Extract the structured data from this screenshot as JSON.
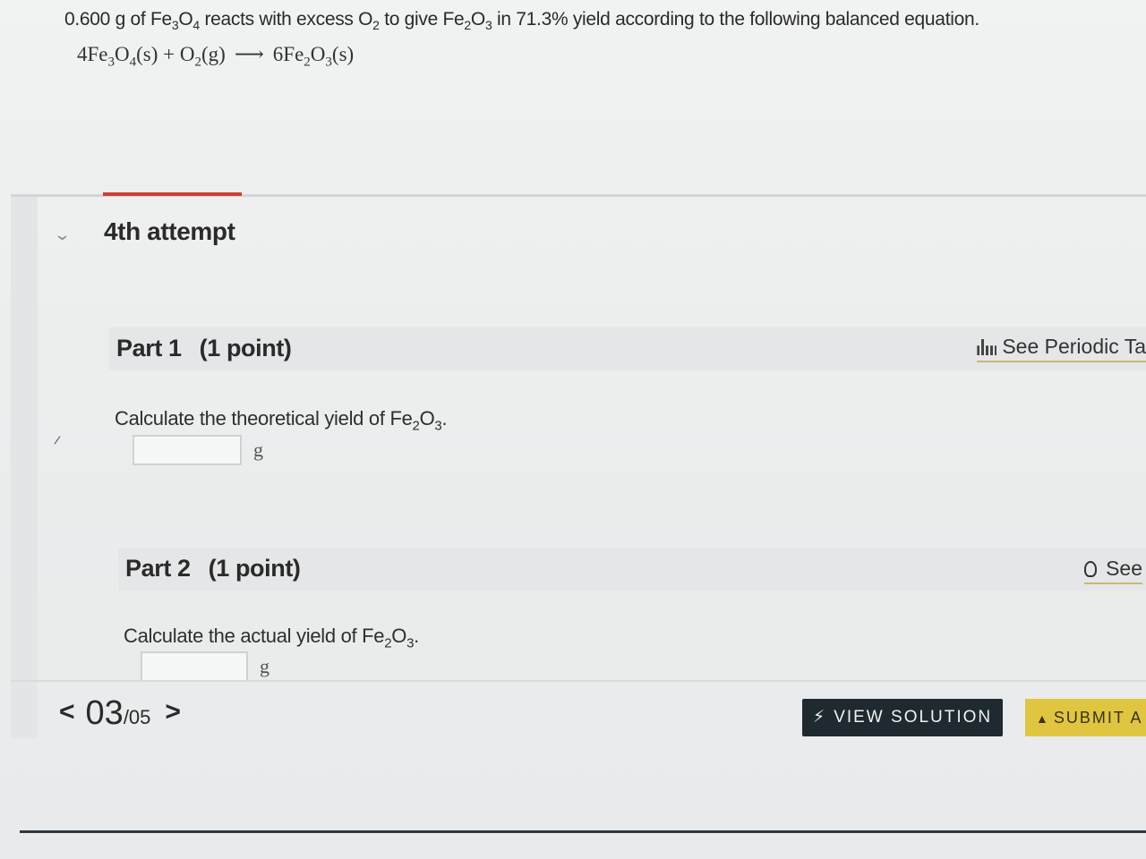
{
  "question": {
    "amount": "0.600 g of Fe",
    "sub_a": "3",
    "o_a": "O",
    "sub_b": "4",
    "mid": " reacts with excess O",
    "sub_c": "2",
    "mid2": " to give Fe",
    "sub_d": "2",
    "o_b": "O",
    "sub_e": "3",
    "tail": " in 71.3% yield according to the following balanced equation."
  },
  "equation": {
    "r1": "4Fe",
    "r1s1": "3",
    "r1o": "O",
    "r1s2": "4",
    "r1state": "(s) + O",
    "r2s": "2",
    "r2state": "(g)",
    "arrow": "⟶",
    "p1": "6Fe",
    "p1s1": "2",
    "p1o": "O",
    "p1s2": "3",
    "p1state": "(s)"
  },
  "attempt": {
    "label": "4th attempt",
    "chevron": "chevron-down-icon"
  },
  "part1": {
    "title": "Part 1",
    "points": "(1 point)",
    "link": "See Periodic Ta",
    "prompt_pre": "Calculate the theoretical yield of Fe",
    "prompt_s1": "2",
    "prompt_o": "O",
    "prompt_s2": "3",
    "prompt_end": ".",
    "unit": "g",
    "value": ""
  },
  "part2": {
    "title": "Part 2",
    "points": "(1 point)",
    "link": "See",
    "prompt_pre": "Calculate the actual yield of Fe",
    "prompt_s1": "2",
    "prompt_o": "O",
    "prompt_s2": "3",
    "prompt_end": ".",
    "unit": "g",
    "value": ""
  },
  "pager": {
    "prev": "<",
    "current": "03",
    "total": "/05",
    "next": ">"
  },
  "buttons": {
    "solution_icon": "⚡",
    "solution": "VIEW SOLUTION",
    "submit_icon": "▲",
    "submit": "SUBMIT A"
  },
  "colors": {
    "accent": "#c9432f",
    "dark_button": "#1f2a30",
    "submit_button": "#e0c640"
  }
}
